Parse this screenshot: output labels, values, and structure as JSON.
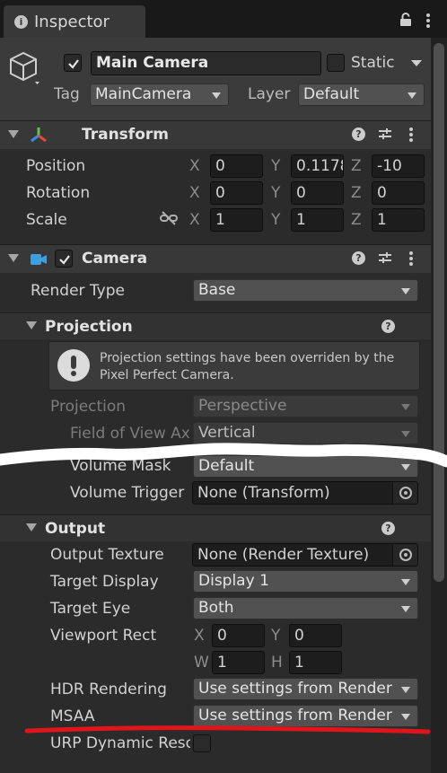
{
  "tab": {
    "title": "Inspector"
  },
  "object": {
    "name": "Main Camera",
    "static_label": "Static",
    "tag_label": "Tag",
    "tag_value": "MainCamera",
    "layer_label": "Layer",
    "layer_value": "Default"
  },
  "transform": {
    "title": "Transform",
    "rows": [
      {
        "label": "Position",
        "x": "0",
        "y": "0.1178",
        "z": "-10"
      },
      {
        "label": "Rotation",
        "x": "0",
        "y": "0",
        "z": "0"
      },
      {
        "label": "Scale",
        "x": "1",
        "y": "1",
        "z": "1"
      }
    ],
    "axis": {
      "x": "X",
      "y": "Y",
      "z": "Z"
    }
  },
  "camera": {
    "title": "Camera",
    "render_type_label": "Render Type",
    "render_type_value": "Base"
  },
  "projection": {
    "title": "Projection",
    "help_text": "Projection settings have been overriden by the Pixel Perfect Camera.",
    "projection_label": "Projection",
    "projection_value": "Perspective",
    "fov_axis_label": "Field of View Ax",
    "fov_axis_value": "Vertical",
    "volume_mask_label": "Volume Mask",
    "volume_mask_value": "Default",
    "volume_trigger_label": "Volume Trigger",
    "volume_trigger_value": "None (Transform)"
  },
  "output": {
    "title": "Output",
    "output_texture_label": "Output Texture",
    "output_texture_value": "None (Render Texture)",
    "target_display_label": "Target Display",
    "target_display_value": "Display 1",
    "target_eye_label": "Target Eye",
    "target_eye_value": "Both",
    "viewport_label": "Viewport Rect",
    "viewport": {
      "x_label": "X",
      "x": "0",
      "y_label": "Y",
      "y": "0",
      "w_label": "W",
      "w": "1",
      "h_label": "H",
      "h": "1"
    },
    "hdr_label": "HDR Rendering",
    "hdr_value": "Use settings from Render",
    "msaa_label": "MSAA",
    "msaa_value": "Use settings from Render",
    "urp_label": "URP Dynamic Reso"
  },
  "colors": {
    "annotation_red": "#e0141b",
    "redaction_white": "#ffffff",
    "panel_bg": "#2b2b2b",
    "header_bg": "#383838"
  }
}
